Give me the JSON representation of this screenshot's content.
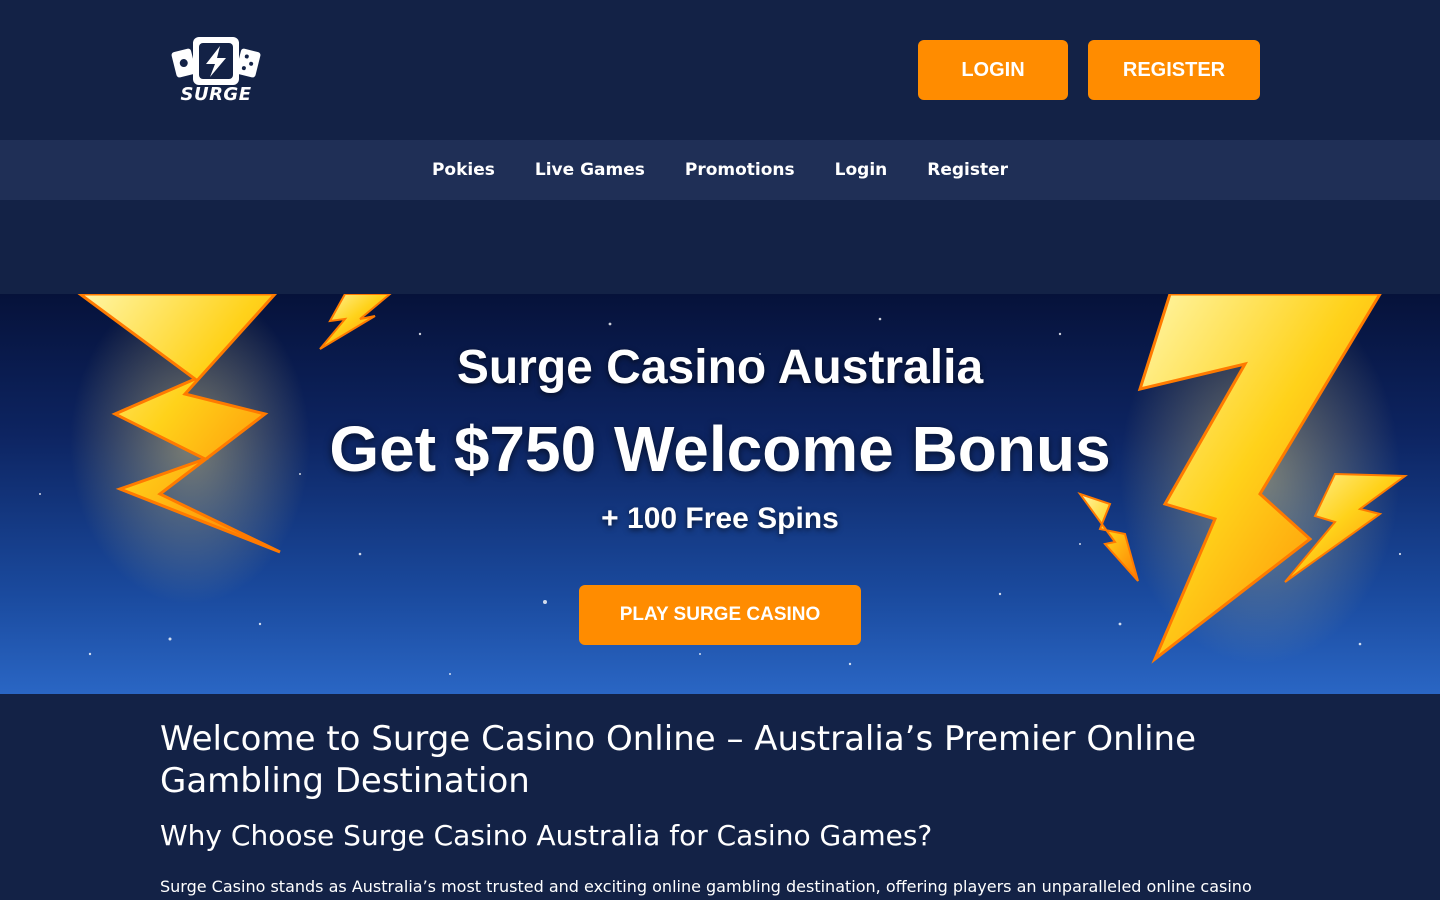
{
  "header": {
    "logo_text": "SURGE",
    "login_label": "LOGIN",
    "register_label": "REGISTER"
  },
  "nav": {
    "items": [
      {
        "label": "Pokies"
      },
      {
        "label": "Live Games"
      },
      {
        "label": "Promotions"
      },
      {
        "label": "Login"
      },
      {
        "label": "Register"
      }
    ]
  },
  "hero": {
    "title": "Surge Casino Australia",
    "bonus": "Get $750 Welcome Bonus",
    "spins": "+ 100 Free Spins",
    "cta_label": "PLAY SURGE CASINO"
  },
  "content": {
    "heading": "Welcome to Surge Casino Online – Australia’s Premier Online Gambling Destination",
    "subheading": "Why Choose Surge Casino Australia for Casino Games?",
    "paragraph": "Surge Casino stands as Australia’s most trusted and exciting online gambling destination, offering players an unparalleled online casino"
  },
  "colors": {
    "background": "#132246",
    "nav_background": "#1f2f56",
    "accent": "#ff8c00",
    "text": "#ffffff"
  },
  "icons": {
    "logo": "surge-cards-lightning-logo",
    "hero_decoration": "lightning-bolt-icon"
  }
}
